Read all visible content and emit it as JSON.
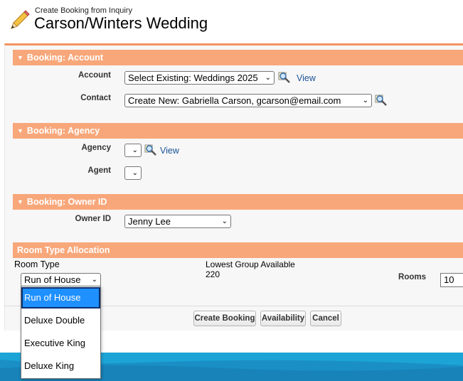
{
  "header": {
    "subtitle": "Create Booking from Inquiry",
    "title": "Carson/Winters Wedding"
  },
  "sections": {
    "account": {
      "title": "Booking: Account",
      "account_label": "Account",
      "account_value": "Select Existing: Weddings 2025",
      "account_view": "View",
      "contact_label": "Contact",
      "contact_value": "Create New: Gabriella Carson, gcarson@email.com"
    },
    "agency": {
      "title": "Booking: Agency",
      "agency_label": "Agency",
      "agency_view": "View",
      "agent_label": "Agent"
    },
    "owner": {
      "title": "Booking: Owner ID",
      "owner_label": "Owner ID",
      "owner_value": "Jenny Lee"
    },
    "room_type": {
      "title": "Room Type Allocation",
      "room_type_label": "Room Type",
      "room_type_value": "Run of House",
      "lowest_group_label": "Lowest Group Available",
      "lowest_group_value": "220",
      "rooms_label": "Rooms",
      "rooms_value": "10"
    }
  },
  "buttons": {
    "create_booking": "Create Booking",
    "availability": "Availability",
    "cancel": "Cancel"
  },
  "dropdown": {
    "options": [
      "Run of House",
      "Deluxe Double",
      "Executive King",
      "Deluxe King"
    ],
    "selected_index": 0
  },
  "colors": {
    "section_header": "#f8a77a",
    "panel_border": "#f19460",
    "link": "#1b5297",
    "selected_option": "#1e90ff",
    "footer": "#1a8fc6"
  }
}
